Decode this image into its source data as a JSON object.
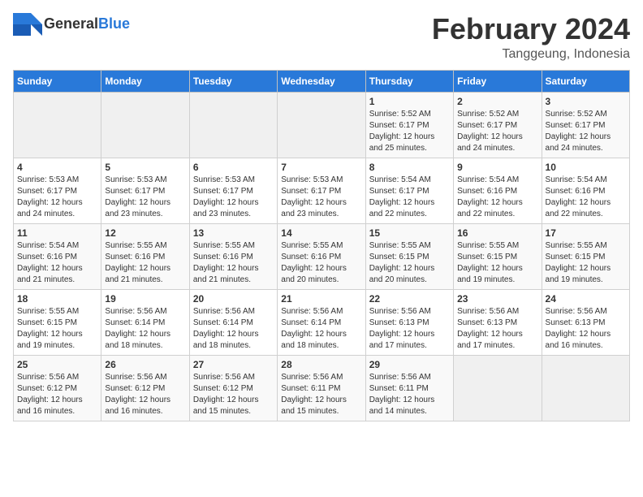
{
  "header": {
    "logo": {
      "general": "General",
      "blue": "Blue",
      "icon": "▶"
    },
    "title": "February 2024",
    "subtitle": "Tanggeung, Indonesia"
  },
  "weekdays": [
    "Sunday",
    "Monday",
    "Tuesday",
    "Wednesday",
    "Thursday",
    "Friday",
    "Saturday"
  ],
  "weeks": [
    [
      {
        "day": "",
        "detail": ""
      },
      {
        "day": "",
        "detail": ""
      },
      {
        "day": "",
        "detail": ""
      },
      {
        "day": "",
        "detail": ""
      },
      {
        "day": "1",
        "detail": "Sunrise: 5:52 AM\nSunset: 6:17 PM\nDaylight: 12 hours\nand 25 minutes."
      },
      {
        "day": "2",
        "detail": "Sunrise: 5:52 AM\nSunset: 6:17 PM\nDaylight: 12 hours\nand 24 minutes."
      },
      {
        "day": "3",
        "detail": "Sunrise: 5:52 AM\nSunset: 6:17 PM\nDaylight: 12 hours\nand 24 minutes."
      }
    ],
    [
      {
        "day": "4",
        "detail": "Sunrise: 5:53 AM\nSunset: 6:17 PM\nDaylight: 12 hours\nand 24 minutes."
      },
      {
        "day": "5",
        "detail": "Sunrise: 5:53 AM\nSunset: 6:17 PM\nDaylight: 12 hours\nand 23 minutes."
      },
      {
        "day": "6",
        "detail": "Sunrise: 5:53 AM\nSunset: 6:17 PM\nDaylight: 12 hours\nand 23 minutes."
      },
      {
        "day": "7",
        "detail": "Sunrise: 5:53 AM\nSunset: 6:17 PM\nDaylight: 12 hours\nand 23 minutes."
      },
      {
        "day": "8",
        "detail": "Sunrise: 5:54 AM\nSunset: 6:17 PM\nDaylight: 12 hours\nand 22 minutes."
      },
      {
        "day": "9",
        "detail": "Sunrise: 5:54 AM\nSunset: 6:16 PM\nDaylight: 12 hours\nand 22 minutes."
      },
      {
        "day": "10",
        "detail": "Sunrise: 5:54 AM\nSunset: 6:16 PM\nDaylight: 12 hours\nand 22 minutes."
      }
    ],
    [
      {
        "day": "11",
        "detail": "Sunrise: 5:54 AM\nSunset: 6:16 PM\nDaylight: 12 hours\nand 21 minutes."
      },
      {
        "day": "12",
        "detail": "Sunrise: 5:55 AM\nSunset: 6:16 PM\nDaylight: 12 hours\nand 21 minutes."
      },
      {
        "day": "13",
        "detail": "Sunrise: 5:55 AM\nSunset: 6:16 PM\nDaylight: 12 hours\nand 21 minutes."
      },
      {
        "day": "14",
        "detail": "Sunrise: 5:55 AM\nSunset: 6:16 PM\nDaylight: 12 hours\nand 20 minutes."
      },
      {
        "day": "15",
        "detail": "Sunrise: 5:55 AM\nSunset: 6:15 PM\nDaylight: 12 hours\nand 20 minutes."
      },
      {
        "day": "16",
        "detail": "Sunrise: 5:55 AM\nSunset: 6:15 PM\nDaylight: 12 hours\nand 19 minutes."
      },
      {
        "day": "17",
        "detail": "Sunrise: 5:55 AM\nSunset: 6:15 PM\nDaylight: 12 hours\nand 19 minutes."
      }
    ],
    [
      {
        "day": "18",
        "detail": "Sunrise: 5:55 AM\nSunset: 6:15 PM\nDaylight: 12 hours\nand 19 minutes."
      },
      {
        "day": "19",
        "detail": "Sunrise: 5:56 AM\nSunset: 6:14 PM\nDaylight: 12 hours\nand 18 minutes."
      },
      {
        "day": "20",
        "detail": "Sunrise: 5:56 AM\nSunset: 6:14 PM\nDaylight: 12 hours\nand 18 minutes."
      },
      {
        "day": "21",
        "detail": "Sunrise: 5:56 AM\nSunset: 6:14 PM\nDaylight: 12 hours\nand 18 minutes."
      },
      {
        "day": "22",
        "detail": "Sunrise: 5:56 AM\nSunset: 6:13 PM\nDaylight: 12 hours\nand 17 minutes."
      },
      {
        "day": "23",
        "detail": "Sunrise: 5:56 AM\nSunset: 6:13 PM\nDaylight: 12 hours\nand 17 minutes."
      },
      {
        "day": "24",
        "detail": "Sunrise: 5:56 AM\nSunset: 6:13 PM\nDaylight: 12 hours\nand 16 minutes."
      }
    ],
    [
      {
        "day": "25",
        "detail": "Sunrise: 5:56 AM\nSunset: 6:12 PM\nDaylight: 12 hours\nand 16 minutes."
      },
      {
        "day": "26",
        "detail": "Sunrise: 5:56 AM\nSunset: 6:12 PM\nDaylight: 12 hours\nand 16 minutes."
      },
      {
        "day": "27",
        "detail": "Sunrise: 5:56 AM\nSunset: 6:12 PM\nDaylight: 12 hours\nand 15 minutes."
      },
      {
        "day": "28",
        "detail": "Sunrise: 5:56 AM\nSunset: 6:11 PM\nDaylight: 12 hours\nand 15 minutes."
      },
      {
        "day": "29",
        "detail": "Sunrise: 5:56 AM\nSunset: 6:11 PM\nDaylight: 12 hours\nand 14 minutes."
      },
      {
        "day": "",
        "detail": ""
      },
      {
        "day": "",
        "detail": ""
      }
    ]
  ]
}
